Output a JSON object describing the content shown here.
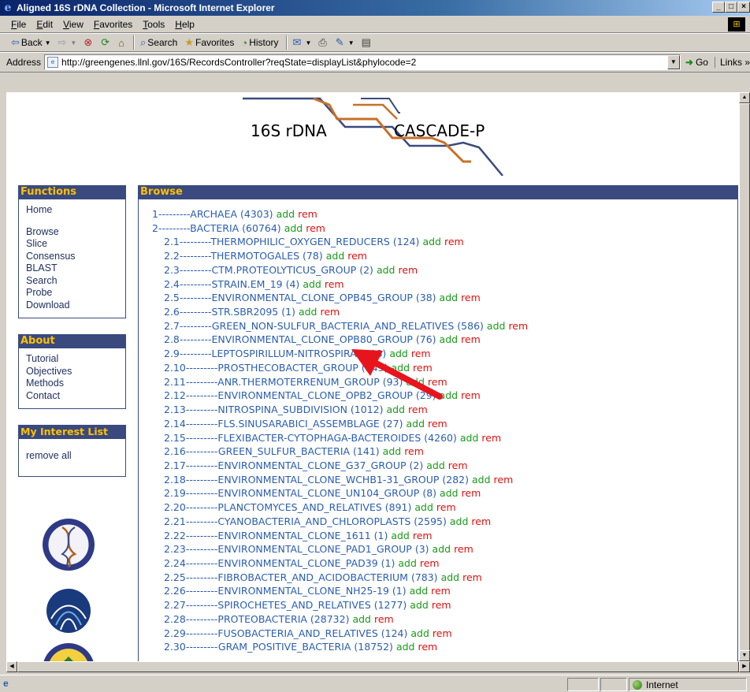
{
  "window": {
    "title": "Aligned 16S rDNA Collection - Microsoft Internet Explorer",
    "controls": [
      "_",
      "□",
      "×"
    ]
  },
  "menu": [
    "File",
    "Edit",
    "View",
    "Favorites",
    "Tools",
    "Help"
  ],
  "toolbar": {
    "back": "Back",
    "forward": "",
    "stop": "",
    "refresh": "",
    "home": "",
    "search": "Search",
    "favorites": "Favorites",
    "history": "History"
  },
  "address": {
    "label": "Address",
    "url": "http://greengenes.llnl.gov/16S/RecordsController?reqState=displayList&phylocode=2",
    "go": "Go",
    "links": "Links"
  },
  "banner": {
    "left_text": "16S rDNA",
    "right_text": "CASCADE-P"
  },
  "functions": {
    "heading": "Functions",
    "home": "Home",
    "items": [
      "Browse",
      "Slice",
      "Consensus",
      "BLAST",
      "Search",
      "Probe",
      "Download"
    ]
  },
  "about": {
    "heading": "About",
    "items": [
      "Tutorial",
      "Objectives",
      "Methods",
      "Contact"
    ]
  },
  "interest": {
    "heading": "My Interest List",
    "remove_all": "remove all"
  },
  "browse": {
    "heading": "Browse",
    "add_label": "add",
    "rem_label": "rem",
    "rows": [
      {
        "indent": 0,
        "text": "1---------ARCHAEA (4303)"
      },
      {
        "indent": 0,
        "text": "2---------BACTERIA (60764)"
      },
      {
        "indent": 1,
        "text": "2.1---------THERMOPHILIC_OXYGEN_REDUCERS (124)"
      },
      {
        "indent": 1,
        "text": "2.2---------THERMOTOGALES (78)"
      },
      {
        "indent": 1,
        "text": "2.3---------CTM.PROTEOLYTICUS_GROUP (2)"
      },
      {
        "indent": 1,
        "text": "2.4---------STRAIN.EM_19 (4)"
      },
      {
        "indent": 1,
        "text": "2.5---------ENVIRONMENTAL_CLONE_OPB45_GROUP (38)"
      },
      {
        "indent": 1,
        "text": "2.6---------STR.SBR2095 (1)"
      },
      {
        "indent": 1,
        "text": "2.7---------GREEN_NON-SULFUR_BACTERIA_AND_RELATIVES (586)"
      },
      {
        "indent": 1,
        "text": "2.8---------ENVIRONMENTAL_CLONE_OPB80_GROUP (76)"
      },
      {
        "indent": 1,
        "text": "2.9---------LEPTOSPIRILLUM-NITROSPIRA (298)"
      },
      {
        "indent": 1,
        "text": "2.10---------PROSTHECOBACTER_GROUP (543)"
      },
      {
        "indent": 1,
        "text": "2.11---------ANR.THERMOTERRENUM_GROUP (93)"
      },
      {
        "indent": 1,
        "text": "2.12---------ENVIRONMENTAL_CLONE_OPB2_GROUP (29)"
      },
      {
        "indent": 1,
        "text": "2.13---------NITROSPINA_SUBDIVISION (1012)"
      },
      {
        "indent": 1,
        "text": "2.14---------FLS.SINUSARABICI_ASSEMBLAGE (27)"
      },
      {
        "indent": 1,
        "text": "2.15---------FLEXIBACTER-CYTOPHAGA-BACTEROIDES (4260)"
      },
      {
        "indent": 1,
        "text": "2.16---------GREEN_SULFUR_BACTERIA (141)"
      },
      {
        "indent": 1,
        "text": "2.17---------ENVIRONMENTAL_CLONE_G37_GROUP (2)"
      },
      {
        "indent": 1,
        "text": "2.18---------ENVIRONMENTAL_CLONE_WCHB1-31_GROUP (282)"
      },
      {
        "indent": 1,
        "text": "2.19---------ENVIRONMENTAL_CLONE_UN104_GROUP (8)"
      },
      {
        "indent": 1,
        "text": "2.20---------PLANCTOMYCES_AND_RELATIVES (891)"
      },
      {
        "indent": 1,
        "text": "2.21---------CYANOBACTERIA_AND_CHLOROPLASTS (2595)"
      },
      {
        "indent": 1,
        "text": "2.22---------ENVIRONMENTAL_CLONE_1611 (1)"
      },
      {
        "indent": 1,
        "text": "2.23---------ENVIRONMENTAL_CLONE_PAD1_GROUP (3)"
      },
      {
        "indent": 1,
        "text": "2.24---------ENVIRONMENTAL_CLONE_PAD39 (1)"
      },
      {
        "indent": 1,
        "text": "2.25---------FIBROBACTER_AND_ACIDOBACTERIUM (783)"
      },
      {
        "indent": 1,
        "text": "2.26---------ENVIRONMENTAL_CLONE_NH25-19 (1)"
      },
      {
        "indent": 1,
        "text": "2.27---------SPIROCHETES_AND_RELATIVES (1277)"
      },
      {
        "indent": 1,
        "text": "2.28---------PROTEOBACTERIA (28732)"
      },
      {
        "indent": 1,
        "text": "2.29---------FUSOBACTERIA_AND_RELATIVES (124)"
      },
      {
        "indent": 1,
        "text": "2.30---------GRAM_POSITIVE_BACTERIA (18752)"
      }
    ]
  },
  "status": {
    "zone": "Internet"
  },
  "colors": {
    "panel_header_bg": "#3a4a7e",
    "panel_header_text": "#ffc000",
    "link_blue": "#2a5db0",
    "add_green": "#1a9a1a",
    "rem_red": "#e01010",
    "arrow_red": "#e8141c",
    "logo_blue": "#3a4a7e",
    "logo_orange": "#c8702a"
  },
  "icons": {
    "title": "ie-logo-icon",
    "address_page": "page-icon",
    "go": "go-arrow-icon",
    "status": "ie-page-icon",
    "zone": "globe-icon"
  }
}
